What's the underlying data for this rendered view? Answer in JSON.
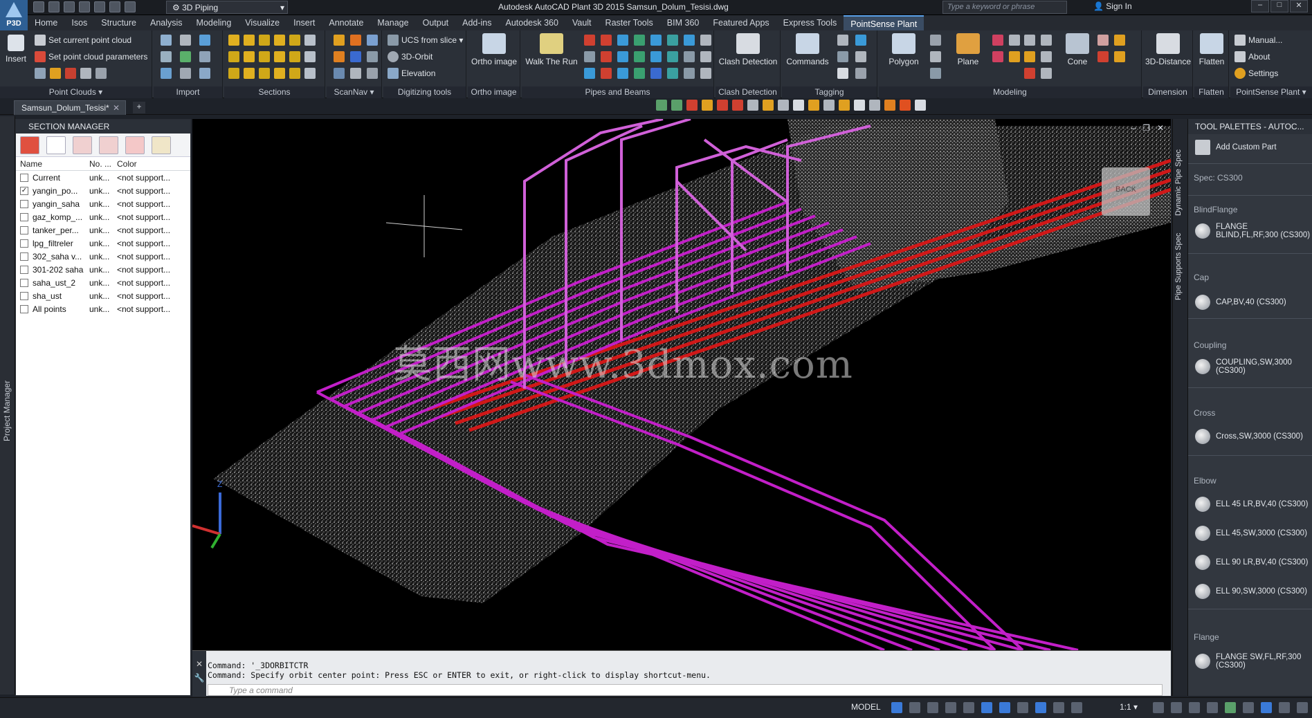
{
  "titlebar": {
    "app_badge": "P3D",
    "workspace": "3D Piping",
    "document_title": "Autodesk AutoCAD Plant 3D 2015    Samsun_Dolum_Tesisi.dwg",
    "search_placeholder": "Type a keyword or phrase",
    "signin": "Sign In",
    "minimize": "–",
    "maximize": "□",
    "close": "✕"
  },
  "menu": {
    "tabs": [
      "Home",
      "Isos",
      "Structure",
      "Analysis",
      "Modeling",
      "Visualize",
      "Insert",
      "Annotate",
      "Manage",
      "Output",
      "Add-ins",
      "Autodesk 360",
      "Vault",
      "Raster Tools",
      "BIM 360",
      "Featured Apps",
      "Express Tools",
      "PointSense Plant"
    ],
    "active_tab": "PointSense Plant"
  },
  "ribbon": {
    "insert": "Insert",
    "set_current_point_cloud": "Set current point cloud",
    "set_point_cloud_parameters": "Set point cloud parameters",
    "panel_point_clouds": "Point Clouds ▾",
    "panel_import": "Import",
    "panel_sections": "Sections",
    "panel_scannav": "ScanNav ▾",
    "ucs_from_slice": "UCS from slice ▾",
    "orbit_3d": "3D-Orbit",
    "elevation": "Elevation",
    "panel_digitizing": "Digitizing tools",
    "ortho_image_btn": "Ortho image",
    "panel_ortho_image": "Ortho image",
    "walk_the_run": "Walk The Run",
    "panel_pipes_beams": "Pipes and Beams",
    "clash_detection_btn": "Clash Detection",
    "panel_clash_detection": "Clash Detection",
    "commands": "Commands",
    "panel_tagging": "Tagging",
    "polygon": "Polygon",
    "plane": "Plane",
    "cone": "Cone",
    "panel_modeling": "Modeling",
    "distance_3d": "3D-Distance",
    "panel_dimension": "Dimension",
    "flatten_btn": "Flatten",
    "panel_flatten": "Flatten",
    "manual": "Manual...",
    "about": "About",
    "settings": "Settings",
    "panel_pointsense": "PointSense Plant ▾"
  },
  "doc_tabs": {
    "active": "Samsun_Dolum_Tesisi*",
    "close": "✕",
    "add": "+"
  },
  "left_strip": {
    "label": "Project Manager"
  },
  "section_manager": {
    "title": "SECTION MANAGER",
    "columns": [
      "Name",
      "No. ...",
      "Color"
    ],
    "rows": [
      {
        "name": "Current",
        "no": "unk...",
        "color": "<not support...",
        "checked": ""
      },
      {
        "name": "yangin_po...",
        "no": "unk...",
        "color": "<not support...",
        "checked": "✓"
      },
      {
        "name": "yangin_saha",
        "no": "unk...",
        "color": "<not support...",
        "checked": ""
      },
      {
        "name": "gaz_komp_...",
        "no": "unk...",
        "color": "<not support...",
        "checked": ""
      },
      {
        "name": "tanker_per...",
        "no": "unk...",
        "color": "<not support...",
        "checked": ""
      },
      {
        "name": "lpg_filtreler",
        "no": "unk...",
        "color": "<not support...",
        "checked": ""
      },
      {
        "name": "302_saha v...",
        "no": "unk...",
        "color": "<not support...",
        "checked": ""
      },
      {
        "name": "301-202 saha",
        "no": "unk...",
        "color": "<not support...",
        "checked": ""
      },
      {
        "name": "saha_ust_2",
        "no": "unk...",
        "color": "<not support...",
        "checked": ""
      },
      {
        "name": "sha_ust",
        "no": "unk...",
        "color": "<not support...",
        "checked": ""
      },
      {
        "name": "All points",
        "no": "unk...",
        "color": "<not support...",
        "checked": ""
      }
    ]
  },
  "viewport": {
    "watermark": "莫西网www.3dmox.com",
    "viewcube_label": "BACK",
    "minimize": "–",
    "restore": "❐",
    "close": "✕",
    "axis_z": "Z",
    "pipe_color": "#c21fc8",
    "red_pipe_color": "#d01818"
  },
  "command": {
    "history_1": "Command: '_3DORBITCTR",
    "history_2": "Command: Specify orbit center point: Press ESC or ENTER to exit, or right-click to display shortcut-menu.",
    "placeholder": "Type a command",
    "close": "✕"
  },
  "tool_palette": {
    "title": "TOOL PALETTES - AUTOC...",
    "vertical_tabs": [
      "Dynamic Pipe Spec",
      "Pipe Supports Spec"
    ],
    "add_custom_part": "Add Custom Part",
    "spec": "Spec: CS300",
    "categories": {
      "blind_flange": "BlindFlange",
      "cap": "Cap",
      "coupling": "Coupling",
      "cross": "Cross",
      "elbow": "Elbow",
      "flange": "Flange"
    },
    "items": {
      "flange_blind": "FLANGE BLIND,FL,RF,300 (CS300)",
      "cap": "CAP,BV,40 (CS300)",
      "coupling": "COUPLING,SW,3000 (CS300)",
      "cross": "Cross,SW,3000 (CS300)",
      "ell45_lr": "ELL 45 LR,BV,40 (CS300)",
      "ell45_sw": "ELL 45,SW,3000 (CS300)",
      "ell90_lr": "ELL 90 LR,BV,40 (CS300)",
      "ell90_sw": "ELL 90,SW,3000 (CS300)",
      "flange_sw": "FLANGE SW,FL,RF,300 (CS300)"
    }
  },
  "status": {
    "model": "MODEL",
    "scale": "1:1 ▾"
  }
}
